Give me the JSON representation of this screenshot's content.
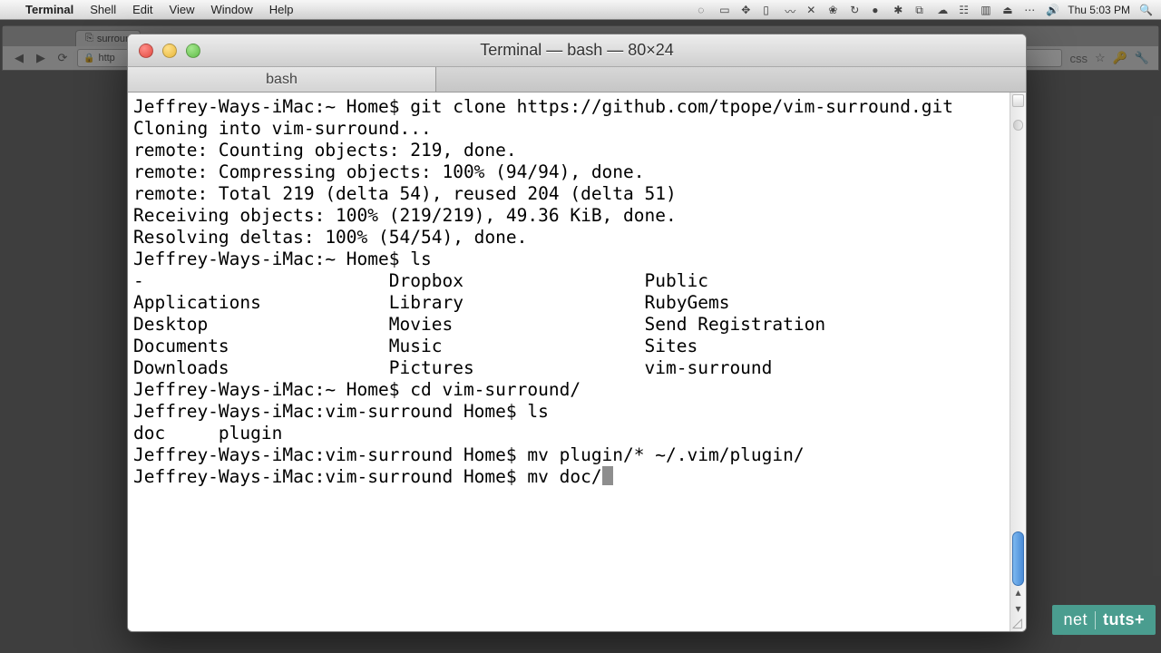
{
  "menubar": {
    "apple": "",
    "appname": "Terminal",
    "menus": [
      "Shell",
      "Edit",
      "View",
      "Window",
      "Help"
    ],
    "clock": "Thu 5:03 PM"
  },
  "browser": {
    "tab_label": "surroun",
    "url_prefix": "http",
    "css_label": "css",
    "star": "☆"
  },
  "terminal": {
    "title": "Terminal — bash — 80×24",
    "tab_label": "bash",
    "lines": [
      "Jeffrey-Ways-iMac:~ Home$ git clone https://github.com/tpope/vim-surround.git",
      "Cloning into vim-surround...",
      "remote: Counting objects: 219, done.",
      "remote: Compressing objects: 100% (94/94), done.",
      "remote: Total 219 (delta 54), reused 204 (delta 51)",
      "Receiving objects: 100% (219/219), 49.36 KiB, done.",
      "Resolving deltas: 100% (54/54), done.",
      "Jeffrey-Ways-iMac:~ Home$ ls",
      "-                       Dropbox                 Public",
      "Applications            Library                 RubyGems",
      "Desktop                 Movies                  Send Registration",
      "Documents               Music                   Sites",
      "Downloads               Pictures                vim-surround",
      "Jeffrey-Ways-iMac:~ Home$ cd vim-surround/",
      "Jeffrey-Ways-iMac:vim-surround Home$ ls",
      "doc     plugin",
      "Jeffrey-Ways-iMac:vim-surround Home$ mv plugin/* ~/.vim/plugin/",
      "Jeffrey-Ways-iMac:vim-surround Home$ mv doc/"
    ]
  },
  "badge": {
    "seg1": "net",
    "seg2": "tuts+"
  }
}
